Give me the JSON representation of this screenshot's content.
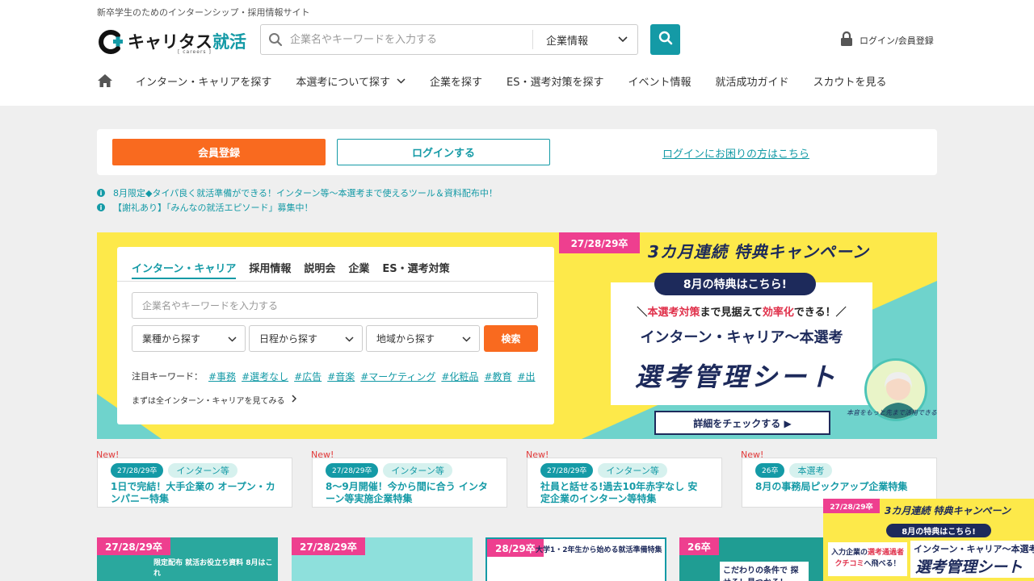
{
  "header": {
    "tagline": "新卒学生のためのインターンシップ・採用情報サイト",
    "logo_text": "キャリタス",
    "logo_accent": "就活",
    "logo_sub": "[ careers ]",
    "search_placeholder": "企業名やキーワードを入力する",
    "search_category": "企業情報",
    "login_label": "ログイン/会員登録"
  },
  "nav": {
    "items": [
      {
        "label": "インターン・キャリアを探す"
      },
      {
        "label": "本選考について探す"
      },
      {
        "label": "企業を探す"
      },
      {
        "label": "ES・選考対策を探す"
      },
      {
        "label": "イベント情報"
      },
      {
        "label": "就活成功ガイド"
      },
      {
        "label": "スカウトを見る"
      }
    ]
  },
  "member": {
    "register": "会員登録",
    "login": "ログインする",
    "help": "ログインにお困りの方はこちら"
  },
  "notices": [
    "8月限定◆タイパ良く就活準備ができる！インターン等〜本選考まで使えるツール＆資料配布中！",
    "【謝礼あり】「みんなの就活エピソード」募集中！"
  ],
  "search_card": {
    "tabs": [
      "インターン・キャリア",
      "採用情報",
      "説明会",
      "企業",
      "ES・選考対策"
    ],
    "placeholder": "企業名やキーワードを入力する",
    "filters": [
      "業種から探す",
      "日程から探す",
      "地域から探す"
    ],
    "search_button": "検索",
    "keywords_label": "注目キーワード：",
    "keywords": [
      "#事務",
      "#選考なし",
      "#広告",
      "#音楽",
      "#マーケティング",
      "#化粧品",
      "#教育",
      "#出"
    ],
    "see_all": "まずは全インターン・キャリアを見てみる"
  },
  "banner": {
    "tag": "27/28/29卒",
    "campaign": "3カ月連続 特典キャンペーン",
    "month_pill": "8月の特典はこちら!",
    "line1_prefix": "＼",
    "line1_red1": "本選考対策",
    "line1_mid": "まで見据えて",
    "line1_red2": "効率化",
    "line1_suffix": "できる！／",
    "line2": "インターン・キャリア〜本選考",
    "line3": "選考管理シート",
    "detail_button": "詳細をチェックする ▶",
    "avatar_note": "本音をもっと先まで活用できる"
  },
  "features": [
    {
      "new": "New!",
      "year": "27/28/29卒",
      "type": "インターン等",
      "title": "1日で完結！大手企業の オープン・カンパニー特集"
    },
    {
      "new": "New!",
      "year": "27/28/29卒",
      "type": "インターン等",
      "title": "8〜9月開催！今から間に合う インターン等実施企業特集"
    },
    {
      "new": "New!",
      "year": "27/28/29卒",
      "type": "インターン等",
      "title": "社員と話せる!過去10年赤字なし 安定企業のインターン等特集"
    },
    {
      "new": "New!",
      "year": "26卒",
      "type": "本選考",
      "title": "8月の事務局ピックアップ企業特集"
    }
  ],
  "thumbs": [
    {
      "tag": "27/28/29卒",
      "text": "限定配布 就活お役立ち資料 8月はこれ"
    },
    {
      "tag": "27/28/29卒",
      "text": ""
    },
    {
      "tag": "28/29卒",
      "text": "大学1・2年生から始める就活準備特集"
    },
    {
      "tag": "26卒",
      "text": "こだわりの条件で 探せる！見つかる！"
    }
  ],
  "float_banner": {
    "tag": "27/28/29卒",
    "title": "3カ月連続 特典キャンペーン",
    "pill": "8月の特典はこちら!",
    "left1": "入力企業の",
    "left_red": "選考通過者",
    "left2": "クチコミ",
    "left3": "へ飛べる！",
    "right1": "インターン・キャリア〜本選考",
    "right2": "選考管理シート"
  },
  "colors": {
    "teal": "#149aa6",
    "orange": "#f96a1f",
    "pink": "#ee3f8f",
    "navy": "#1d2a5b",
    "yellow": "#fde94a"
  }
}
